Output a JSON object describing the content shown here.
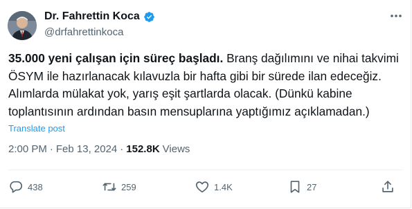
{
  "author": {
    "display_name": "Dr. Fahrettin Koca",
    "handle": "@drfahrettinkoca",
    "verified_icon": "verified-badge-icon",
    "colors": {
      "verified": "#1d9bf0"
    }
  },
  "tweet": {
    "text_bold": "35.000 yeni çalışan için süreç başladı.",
    "text_rest": " Branş dağılımını ve nihai takvimi ÖSYM ile hazırlanacak kılavuzla bir hafta gibi bir sürede ilan edeceğiz. Alımlarda mülakat yok, yarış eşit şartlarda olacak. (Dünkü kabine toplantısının ardından basın mensuplarına yaptığımız açıklamadan.)",
    "translate_label": "Translate post"
  },
  "meta": {
    "time": "2:00 PM",
    "separator1": "·",
    "date": "Feb 13, 2024",
    "separator2": "·",
    "views_count": "152.8K",
    "views_label": "Views"
  },
  "actions": {
    "replies": "438",
    "reposts": "259",
    "likes": "1.4K",
    "bookmarks": "27"
  },
  "colors": {
    "link": "#1d9bf0",
    "secondary_text": "#536471",
    "primary_text": "#0f1419"
  }
}
